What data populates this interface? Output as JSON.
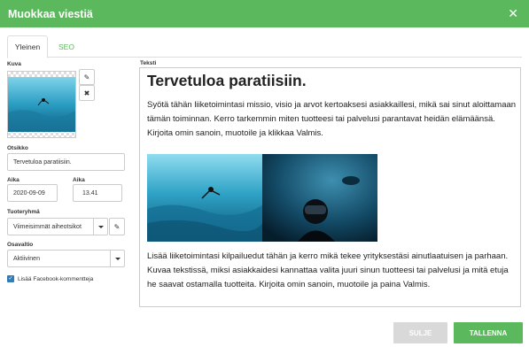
{
  "dialog": {
    "title": "Muokkaa viestiä",
    "close_icon": "close-icon"
  },
  "tabs": [
    {
      "label": "Yleinen",
      "active": true
    },
    {
      "label": "SEO",
      "active": false
    }
  ],
  "form": {
    "image_label": "Kuva",
    "title_label": "Otsikko",
    "title_value": "Tervetuloa paratiisiin.",
    "date_label": "Aika",
    "date_value": "2020-09-09",
    "time_label": "Aika",
    "time_value": "13.41",
    "group_label": "Tuoteryhmä",
    "group_value": "Viimeisimmät aiheotsikot",
    "status_label": "Osavaltio",
    "status_value": "Aktiivinen",
    "facebook_comments_label": "Lisää Facebook-kommentteja",
    "facebook_comments_checked": true
  },
  "editor": {
    "label": "Teksti",
    "heading": "Tervetuloa paratiisiin.",
    "paragraph1": "Syötä tähän liiketoimintasi missio, visio ja arvot kertoaksesi asiakkaillesi, mikä sai sinut aloittamaan tämän toiminnan. Kerro tarkemmin miten tuotteesi tai palvelusi parantavat heidän elämäänsä. Kirjoita omin sanoin, muotoile ja klikkaa Valmis.",
    "paragraph2": "Lisää liiketoimintasi kilpailuedut tähän ja kerro mikä tekee yrityksestäsi ainutlaatuisen ja parhaan. Kuvaa tekstissä, miksi asiakkaidesi kannattaa valita juuri sinun tuotteesi tai palvelusi ja mitä etuja he saavat ostamalla tuotteita. Kirjoita omin sanoin, muotoile ja paina Valmis."
  },
  "buttons": {
    "close": "SULJE",
    "save": "TALLENNA"
  },
  "colors": {
    "primary": "#5cb85c",
    "disabled": "#d9d9d9",
    "checkbox": "#337ab7"
  }
}
